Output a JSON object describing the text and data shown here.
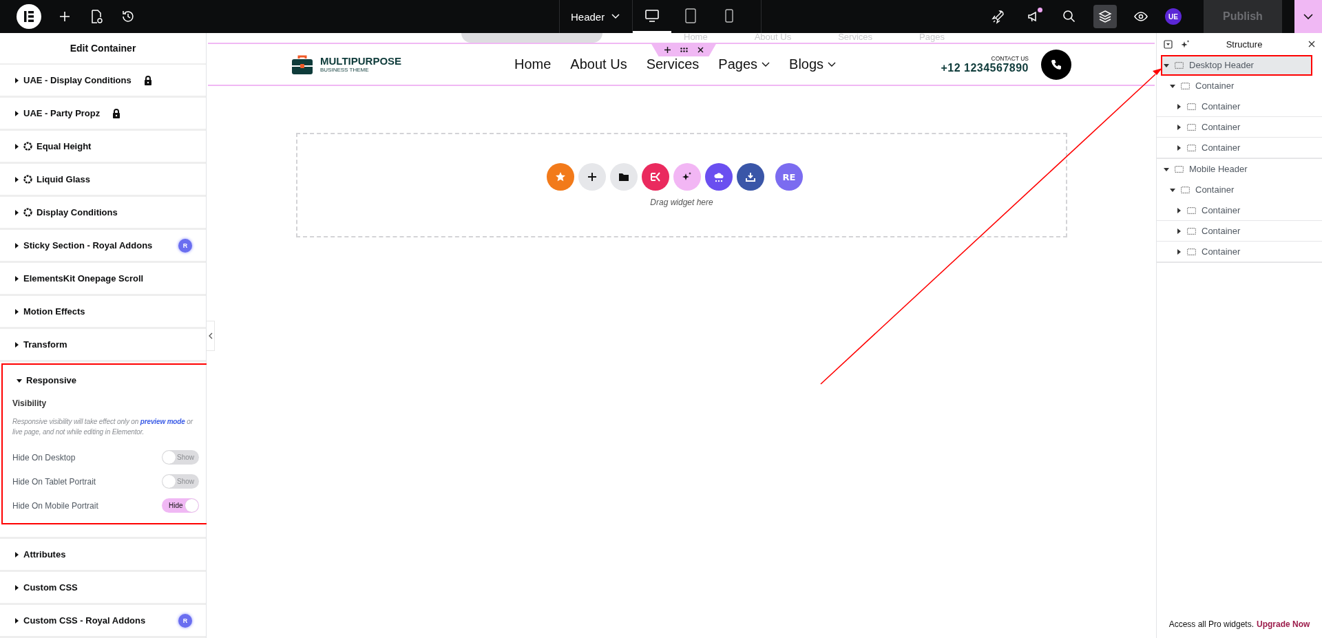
{
  "topbar": {
    "document": "Header",
    "devices": [
      {
        "kind": "desktop",
        "selected": true
      },
      {
        "kind": "tablet",
        "selected": false
      },
      {
        "kind": "mobile",
        "selected": false
      }
    ],
    "notification": true,
    "structure_open": true,
    "avatar": "UE",
    "publish": "Publish",
    "publish_disabled": true
  },
  "panel": {
    "title": "Edit Container",
    "sections": [
      {
        "label": "UAE - Display Conditions",
        "kind": "locked",
        "expanded": false,
        "highlighted": false
      },
      {
        "label": "UAE - Party Propz",
        "kind": "locked",
        "expanded": false,
        "highlighted": false
      },
      {
        "label": "Equal Height",
        "kind": "addon",
        "expanded": false,
        "highlighted": false
      },
      {
        "label": "Liquid Glass",
        "kind": "addon",
        "expanded": false,
        "highlighted": false
      },
      {
        "label": "Display Conditions",
        "kind": "addon",
        "expanded": false,
        "highlighted": false
      },
      {
        "label": "Sticky Section - Royal Addons",
        "badge": "R",
        "expanded": false,
        "highlighted": false
      },
      {
        "label": "ElementsKit Onepage Scroll",
        "expanded": false,
        "highlighted": false
      },
      {
        "label": "Motion Effects",
        "expanded": false,
        "highlighted": false
      },
      {
        "label": "Transform",
        "expanded": false,
        "highlighted": false
      },
      {
        "label": "Responsive",
        "expanded": true,
        "highlighted": true,
        "heading": "Visibility",
        "note_before": "Responsive visibility will take effect only on",
        "note_link": "preview mode",
        "note_after": "or live page, and not while editing in Elementor.",
        "toggles": [
          {
            "label": "Hide On Desktop",
            "on": false,
            "text": "Show"
          },
          {
            "label": "Hide On Tablet Portrait",
            "on": false,
            "text": "Show"
          },
          {
            "label": "Hide On Mobile Portrait",
            "on": true,
            "text": "Hide"
          }
        ]
      },
      {
        "label": "Attributes",
        "expanded": false,
        "highlighted": false
      },
      {
        "label": "Custom CSS",
        "expanded": false,
        "highlighted": false
      },
      {
        "label": "Custom CSS - Royal Addons",
        "badge": "R",
        "expanded": false,
        "highlighted": false
      }
    ]
  },
  "canvas": {
    "ghost_nav": [
      "Home",
      "About Us",
      "Services",
      "Pages"
    ],
    "header": {
      "brand": "MULTIPURPOSE",
      "tagline": "BUSINESS THEME",
      "nav": [
        {
          "label": "Home",
          "dropdown": false
        },
        {
          "label": "About Us",
          "dropdown": false
        },
        {
          "label": "Services",
          "dropdown": false
        },
        {
          "label": "Pages",
          "dropdown": true
        },
        {
          "label": "Blogs",
          "dropdown": true
        }
      ],
      "contact_label": "CONTACT US",
      "phone": "+12 1234567890"
    },
    "dropzone": {
      "buttons": [
        {
          "kind": "star",
          "color": "#f27a1a"
        },
        {
          "kind": "plus",
          "color": "#e6e7ea"
        },
        {
          "kind": "folder",
          "color": "#e6e7ea"
        },
        {
          "kind": "ek",
          "color": "#ea2a5e"
        },
        {
          "kind": "sparkle",
          "color": "#f2b6f4"
        },
        {
          "kind": "cloud",
          "color": "#6a4ff0"
        },
        {
          "kind": "download",
          "color": "#3a56a8"
        },
        {
          "kind": "text",
          "color": "#7b6cf0",
          "label": "RE"
        }
      ],
      "hint": "Drag widget here"
    }
  },
  "structure": {
    "title": "Structure",
    "tree": [
      {
        "label": "Desktop Header",
        "expanded": true,
        "highlighted": true,
        "children": [
          {
            "label": "Container",
            "expanded": true,
            "highlighted": false,
            "children": [
              {
                "label": "Container",
                "expanded": false,
                "highlighted": false
              },
              {
                "label": "Container",
                "expanded": false,
                "highlighted": false
              },
              {
                "label": "Container",
                "expanded": false,
                "highlighted": false
              }
            ]
          }
        ]
      },
      {
        "label": "Mobile Header",
        "expanded": true,
        "highlighted": false,
        "children": [
          {
            "label": "Container",
            "expanded": true,
            "highlighted": false,
            "children": [
              {
                "label": "Container",
                "expanded": false,
                "highlighted": false
              },
              {
                "label": "Container",
                "expanded": false,
                "highlighted": false
              },
              {
                "label": "Container",
                "expanded": false,
                "highlighted": false
              }
            ]
          }
        ]
      }
    ],
    "footer": "Access all Pro widgets.",
    "footer_link": "Upgrade Now"
  }
}
